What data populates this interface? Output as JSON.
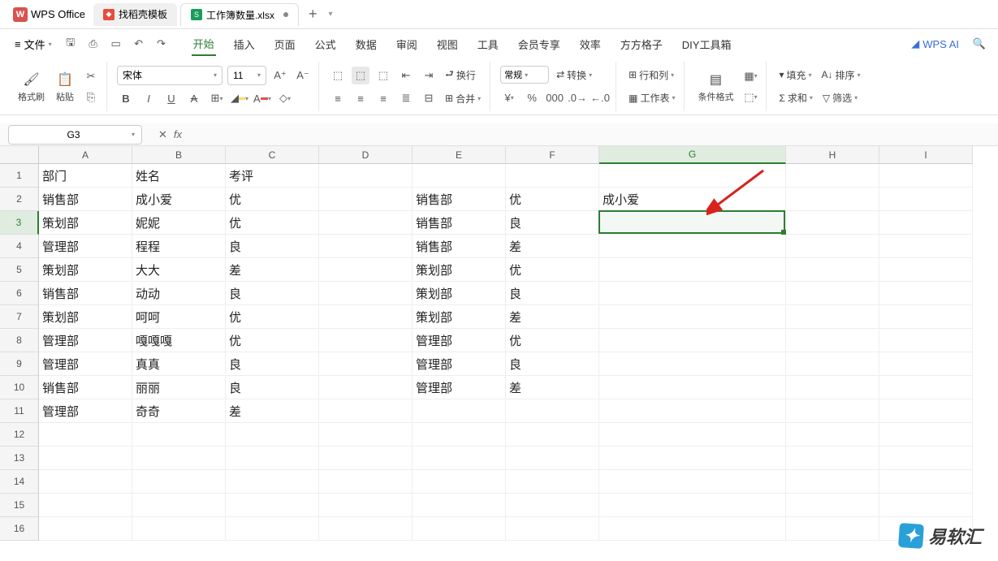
{
  "app": {
    "name": "WPS Office"
  },
  "tabs": [
    {
      "label": "找稻壳模板",
      "icon_color": "#e74c3c"
    },
    {
      "label": "工作簿数量.xlsx",
      "icon_color": "#1a9c5b",
      "icon_letter": "S",
      "modified": true
    }
  ],
  "file_menu": "文件",
  "menu_tabs": [
    "开始",
    "插入",
    "页面",
    "公式",
    "数据",
    "审阅",
    "视图",
    "工具",
    "会员专享",
    "效率",
    "方方格子",
    "DIY工具箱"
  ],
  "active_menu": "开始",
  "wps_ai": "WPS AI",
  "ribbon": {
    "format_painter": "格式刷",
    "paste": "粘贴",
    "font": "宋体",
    "size": "11",
    "wrap": "换行",
    "merge": "合并",
    "number_format": "常规",
    "convert": "转换",
    "rows_cols": "行和列",
    "worksheet": "工作表",
    "cond_format": "条件格式",
    "fill": "填充",
    "sort": "排序",
    "sum": "求和",
    "filter": "筛选"
  },
  "name_box": "G3",
  "columns": [
    "A",
    "B",
    "C",
    "D",
    "E",
    "F",
    "G",
    "H",
    "I"
  ],
  "col_classes": [
    "w-A",
    "w-B",
    "w-C",
    "w-D",
    "w-E",
    "w-F",
    "w-G",
    "w-H",
    "w-I"
  ],
  "highlighted_col": "G",
  "highlighted_row": 3,
  "rows": [
    {
      "n": 1,
      "cells": [
        "部门",
        "姓名",
        "考评",
        "",
        "",
        "",
        "",
        "",
        ""
      ]
    },
    {
      "n": 2,
      "cells": [
        "销售部",
        "成小爱",
        "优",
        "",
        "销售部",
        "优",
        "成小爱",
        "",
        ""
      ]
    },
    {
      "n": 3,
      "cells": [
        "策划部",
        "妮妮",
        "优",
        "",
        "销售部",
        "良",
        "",
        "",
        ""
      ]
    },
    {
      "n": 4,
      "cells": [
        "管理部",
        "程程",
        "良",
        "",
        "销售部",
        "差",
        "",
        "",
        ""
      ]
    },
    {
      "n": 5,
      "cells": [
        "策划部",
        "大大",
        "差",
        "",
        "策划部",
        "优",
        "",
        "",
        ""
      ]
    },
    {
      "n": 6,
      "cells": [
        "销售部",
        "动动",
        "良",
        "",
        "策划部",
        "良",
        "",
        "",
        ""
      ]
    },
    {
      "n": 7,
      "cells": [
        "策划部",
        "呵呵",
        "优",
        "",
        "策划部",
        "差",
        "",
        "",
        ""
      ]
    },
    {
      "n": 8,
      "cells": [
        "管理部",
        "嘎嘎嘎",
        "优",
        "",
        "管理部",
        "优",
        "",
        "",
        ""
      ]
    },
    {
      "n": 9,
      "cells": [
        "管理部",
        "真真",
        "良",
        "",
        "管理部",
        "良",
        "",
        "",
        ""
      ]
    },
    {
      "n": 10,
      "cells": [
        "销售部",
        "丽丽",
        "良",
        "",
        "管理部",
        "差",
        "",
        "",
        ""
      ]
    },
    {
      "n": 11,
      "cells": [
        "管理部",
        "奇奇",
        "差",
        "",
        "",
        "",
        "",
        "",
        ""
      ]
    },
    {
      "n": 12,
      "cells": [
        "",
        "",
        "",
        "",
        "",
        "",
        "",
        "",
        ""
      ]
    },
    {
      "n": 13,
      "cells": [
        "",
        "",
        "",
        "",
        "",
        "",
        "",
        "",
        ""
      ]
    },
    {
      "n": 14,
      "cells": [
        "",
        "",
        "",
        "",
        "",
        "",
        "",
        "",
        ""
      ]
    },
    {
      "n": 15,
      "cells": [
        "",
        "",
        "",
        "",
        "",
        "",
        "",
        "",
        ""
      ]
    },
    {
      "n": 16,
      "cells": [
        "",
        "",
        "",
        "",
        "",
        "",
        "",
        "",
        ""
      ]
    }
  ],
  "selection": {
    "row": 3,
    "col": "G"
  },
  "watermark": "易软汇"
}
